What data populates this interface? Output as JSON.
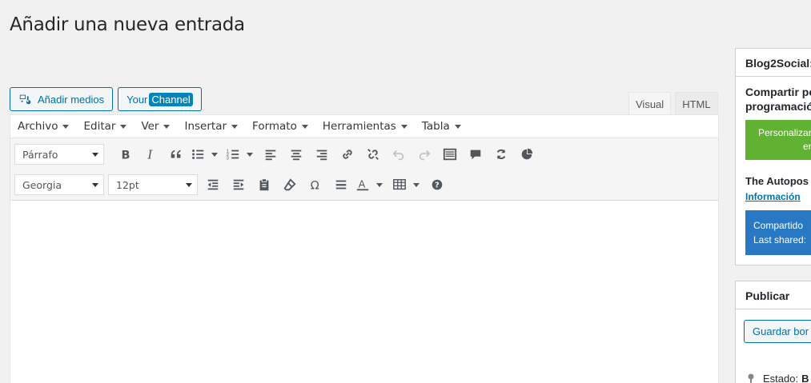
{
  "page": {
    "title": "Añadir una nueva entrada"
  },
  "media": {
    "add_media": "Añadir medios",
    "your": "Your",
    "channel": "Channel"
  },
  "editor_tabs": {
    "visual": "Visual",
    "html": "HTML"
  },
  "menubar": [
    "Archivo",
    "Editar",
    "Ver",
    "Insertar",
    "Formato",
    "Herramientas",
    "Tabla"
  ],
  "toolbar": {
    "block_format": "Párrafo",
    "font_family": "Georgia",
    "font_size": "12pt"
  },
  "sidebar": {
    "b2s": {
      "title": "Blog2Social:",
      "text1_line1": "Compartir po",
      "text1_line2": "programació",
      "green_line1": "Personalizar",
      "green_line2": "en",
      "autopost": "The Autopos",
      "info_link": "Información",
      "blue_line1": "Compartido",
      "blue_line2": "Last shared:"
    },
    "publish": {
      "title": "Publicar",
      "save_draft": "Guardar bor",
      "status_label": "Estado:",
      "status_value": "B"
    }
  },
  "colors": {
    "accent": "#0071a1",
    "green": "#61b233",
    "blue": "#2878c3"
  }
}
